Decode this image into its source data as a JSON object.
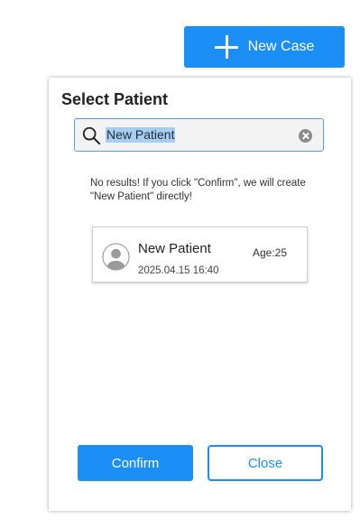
{
  "header": {
    "new_case_label": "New Case"
  },
  "dialog": {
    "title": "Select Patient",
    "search": {
      "value": "New Patient"
    },
    "no_results_message": "No results! If you click \"Confirm\", we will create\n\"New Patient\" directly!",
    "patient_card": {
      "name": "New Patient",
      "age": "Age:25",
      "datetime": "2025.04.15 16:40"
    },
    "confirm_label": "Confirm",
    "close_label": "Close"
  },
  "colors": {
    "primary": "#1b8ff5",
    "search_highlight": "#a9cdf1"
  },
  "icons": [
    "plus-icon",
    "search-icon",
    "clear-icon",
    "avatar-icon"
  ]
}
